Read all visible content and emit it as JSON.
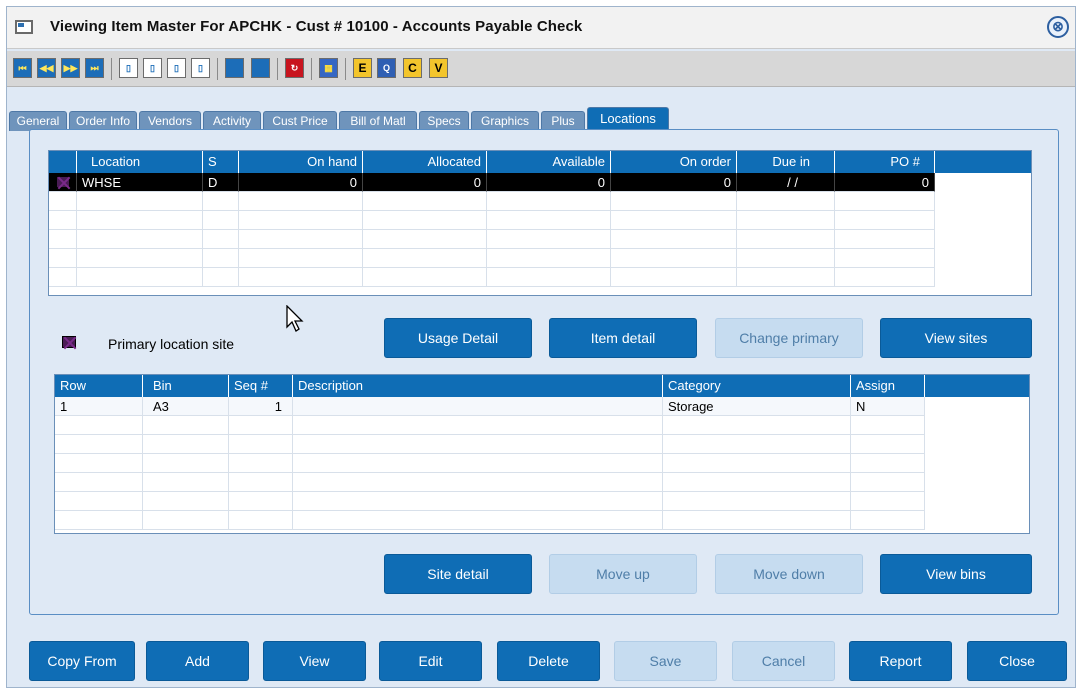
{
  "window": {
    "title": "Viewing Item Master For APCHK -  Cust # 10100 - Accounts Payable Check",
    "close_glyph": "⊗"
  },
  "toolbar": {
    "buttons": [
      {
        "name": "first-record",
        "glyph": "⏮"
      },
      {
        "name": "previous-record",
        "glyph": "◀◀"
      },
      {
        "name": "next-record",
        "glyph": "▶▶"
      },
      {
        "name": "last-record",
        "glyph": "⏭"
      },
      {
        "name": "new-document",
        "glyph": "▯"
      },
      {
        "name": "copy-document",
        "glyph": "▯"
      },
      {
        "name": "edit-document",
        "glyph": "▯"
      },
      {
        "name": "delete-document",
        "glyph": "▯"
      },
      {
        "name": "blue-action-1",
        "glyph": ""
      },
      {
        "name": "blue-action-2",
        "glyph": ""
      },
      {
        "name": "refresh",
        "glyph": "↻"
      },
      {
        "name": "chart",
        "glyph": "▦"
      },
      {
        "name": "letter-e",
        "glyph": "E"
      },
      {
        "name": "lookup",
        "glyph": "Q"
      },
      {
        "name": "letter-c",
        "glyph": "C"
      },
      {
        "name": "letter-v",
        "glyph": "V"
      }
    ]
  },
  "tabs": [
    "General",
    "Order Info",
    "Vendors",
    "Activity",
    "Cust Price",
    "Bill of Matl",
    "Specs",
    "Graphics",
    "Plus",
    "Locations"
  ],
  "active_tab": "Locations",
  "locations_grid": {
    "columns": [
      "Location",
      "S",
      "On hand",
      "Allocated",
      "Available",
      "On order",
      "Due in",
      "PO #"
    ],
    "rows": [
      {
        "location": "WHSE",
        "s": "D",
        "on_hand": "0",
        "allocated": "0",
        "available": "0",
        "on_order": "0",
        "due_in": "/ /",
        "po": "0"
      }
    ]
  },
  "legend": {
    "primary_label": "Primary location site"
  },
  "location_buttons": {
    "usage_detail": "Usage Detail",
    "item_detail": "Item detail",
    "change_primary": "Change primary",
    "view_sites": "View sites"
  },
  "bins_grid": {
    "columns": [
      "Row",
      "Bin",
      "Seq #",
      "Description",
      "Category",
      "Assign"
    ],
    "rows": [
      {
        "row": "1",
        "bin": "A3",
        "seq": "1",
        "description": "",
        "category": "Storage",
        "assign": "N"
      }
    ]
  },
  "bin_buttons": {
    "site_detail": "Site detail",
    "move_up": "Move up",
    "move_down": "Move down",
    "view_bins": "View bins"
  },
  "footer_buttons": {
    "copy_from": "Copy From",
    "add": "Add",
    "view": "View",
    "edit": "Edit",
    "delete": "Delete",
    "save": "Save",
    "cancel": "Cancel",
    "report": "Report",
    "close": "Close"
  },
  "colors": {
    "accent": "#0f6db5",
    "disabled_button": "#c6dcf0",
    "panel_bg": "#dfe9f5",
    "selected_row": "#000000"
  }
}
